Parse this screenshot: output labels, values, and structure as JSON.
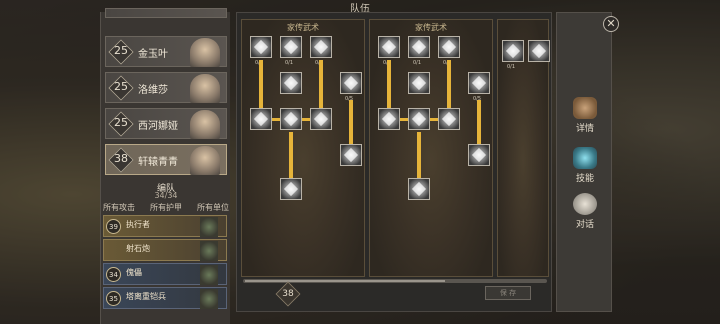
{
  "window_title": "队伍",
  "heroes": [
    {
      "level": "25",
      "name": "金玉叶",
      "selected": false
    },
    {
      "level": "25",
      "name": "洛维莎",
      "selected": false
    },
    {
      "level": "25",
      "name": "西河娜娅",
      "selected": false
    },
    {
      "level": "38",
      "name": "轩辕青青",
      "selected": true
    }
  ],
  "formation": {
    "title": "编队",
    "count": "34/34",
    "filters": [
      "所有攻击",
      "所有护甲",
      "所有单位"
    ],
    "units": [
      {
        "level": "39",
        "name": "执行者",
        "type": "gold"
      },
      {
        "level": "",
        "name": "射石炮",
        "type": "gold"
      },
      {
        "level": "34",
        "name": "傀儡",
        "type": "blue"
      },
      {
        "level": "35",
        "name": "塔离重铠兵",
        "type": "blue"
      }
    ]
  },
  "skill_trees": [
    {
      "title": "家传武术"
    },
    {
      "title": "家传武术"
    }
  ],
  "skill_counts": {
    "zero_one": "0/1",
    "zero_five": "0/5"
  },
  "skill_points": "38",
  "save_label": "保 存",
  "side_nav": [
    {
      "label": "详情",
      "icon": "fist-icon"
    },
    {
      "label": "技能",
      "icon": "skill-book-icon"
    },
    {
      "label": "对话",
      "icon": "speech-bubble-icon"
    }
  ],
  "close_label": "✕",
  "colors": {
    "connector": "#e6b43a",
    "panel": "#2b2a28"
  }
}
